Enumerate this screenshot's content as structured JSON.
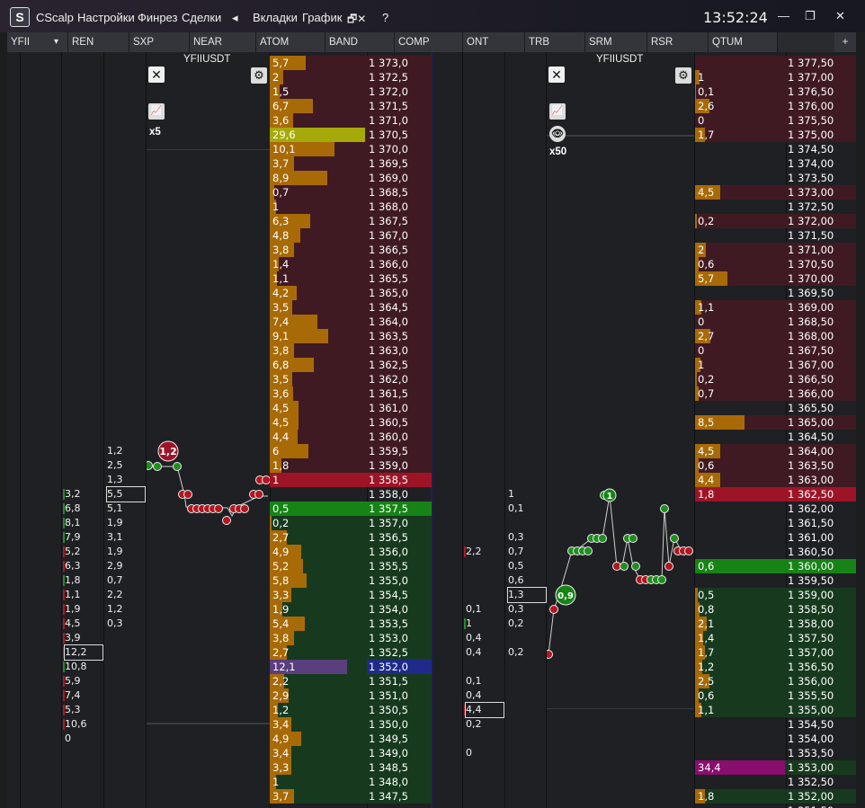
{
  "app": {
    "name": "CScalp",
    "logo_letter": "S"
  },
  "menu": [
    "Настройки",
    "Финрез",
    "Сделки",
    "◂",
    "Вкладки",
    "График",
    "🗗✕",
    "?"
  ],
  "clock": "13:52:24",
  "window_controls": [
    "—",
    "❐",
    "✕"
  ],
  "tabs": [
    "YFII",
    "REN",
    "SXP",
    "NEAR",
    "ATOM",
    "BAND",
    "COMP",
    "ONT",
    "TRB",
    "SRM",
    "RSR",
    "QTUM"
  ],
  "tab_dropdown_icon": "▾",
  "tab_add": "+",
  "left_panel": {
    "symbol": "YFIIUSDT",
    "multiplier": "x5",
    "close_icon": "✕",
    "gear_icon": "⚙",
    "chart_icon": "📈",
    "trade_bubble": "1,2",
    "cluster_a": [
      "3,2",
      "6,8",
      "8,1",
      "7,9",
      "5,2",
      "6,3",
      "1,8",
      "1,1",
      "1,9",
      "4,5",
      "3,9",
      "12,2",
      "10,8",
      "5,9",
      "7,4",
      "5,3",
      "10,6",
      "0"
    ],
    "cluster_b": [
      "1,2",
      "2,5",
      "1,3",
      "5,5",
      "5,1",
      "1,9",
      "3,1",
      "1,9",
      "2,9",
      "0,7",
      "2,2",
      "1,2",
      "0,3"
    ],
    "orderbook": [
      {
        "v": "5,7",
        "p": "1 373,0",
        "side": "ask",
        "w": 40
      },
      {
        "v": "2",
        "p": "1 372,5",
        "side": "ask",
        "w": 15
      },
      {
        "v": "1,5",
        "p": "1 372,0",
        "side": "ask",
        "w": 11
      },
      {
        "v": "6,7",
        "p": "1 371,5",
        "side": "ask",
        "w": 48
      },
      {
        "v": "3,6",
        "p": "1 371,0",
        "side": "ask",
        "w": 26
      },
      {
        "v": "29,6",
        "p": "1 370,5",
        "side": "ask",
        "w": 106,
        "hl": "#a5aa0a"
      },
      {
        "v": "10,1",
        "p": "1 370,0",
        "side": "ask",
        "w": 72
      },
      {
        "v": "3,7",
        "p": "1 369,5",
        "side": "ask",
        "w": 27
      },
      {
        "v": "8,9",
        "p": "1 369,0",
        "side": "ask",
        "w": 64
      },
      {
        "v": "0,7",
        "p": "1 368,5",
        "side": "ask",
        "w": 5
      },
      {
        "v": "1",
        "p": "1 368,0",
        "side": "ask",
        "w": 7
      },
      {
        "v": "6,3",
        "p": "1 367,5",
        "side": "ask",
        "w": 45
      },
      {
        "v": "4,8",
        "p": "1 367,0",
        "side": "ask",
        "w": 34
      },
      {
        "v": "3,8",
        "p": "1 366,5",
        "side": "ask",
        "w": 27
      },
      {
        "v": "1,4",
        "p": "1 366,0",
        "side": "ask",
        "w": 10
      },
      {
        "v": "1,1",
        "p": "1 365,5",
        "side": "ask",
        "w": 8
      },
      {
        "v": "4,2",
        "p": "1 365,0",
        "side": "ask",
        "w": 30
      },
      {
        "v": "3,5",
        "p": "1 364,5",
        "side": "ask",
        "w": 25
      },
      {
        "v": "7,4",
        "p": "1 364,0",
        "side": "ask",
        "w": 53
      },
      {
        "v": "9,1",
        "p": "1 363,5",
        "side": "ask",
        "w": 65
      },
      {
        "v": "3,8",
        "p": "1 363,0",
        "side": "ask",
        "w": 27
      },
      {
        "v": "6,8",
        "p": "1 362,5",
        "side": "ask",
        "w": 49
      },
      {
        "v": "3,5",
        "p": "1 362,0",
        "side": "ask",
        "w": 25
      },
      {
        "v": "3,6",
        "p": "1 361,5",
        "side": "ask",
        "w": 26
      },
      {
        "v": "4,5",
        "p": "1 361,0",
        "side": "ask",
        "w": 32
      },
      {
        "v": "4,5",
        "p": "1 360,5",
        "side": "ask",
        "w": 32
      },
      {
        "v": "4,4",
        "p": "1 360,0",
        "side": "ask",
        "w": 31
      },
      {
        "v": "6",
        "p": "1 359,5",
        "side": "ask",
        "w": 43
      },
      {
        "v": "1,8",
        "p": "1 359,0",
        "side": "ask",
        "w": 13
      },
      {
        "v": "1",
        "p": "1 358,5",
        "side": "bestask",
        "w": 0
      },
      {
        "v": "",
        "p": "1 358,0",
        "side": "empty",
        "w": 0
      },
      {
        "v": "0,5",
        "p": "1 357,5",
        "side": "bestbid",
        "w": 0
      },
      {
        "v": "0,2",
        "p": "1 357,0",
        "side": "bid",
        "w": 2
      },
      {
        "v": "2,7",
        "p": "1 356,5",
        "side": "bid",
        "w": 19
      },
      {
        "v": "4,9",
        "p": "1 356,0",
        "side": "bid",
        "w": 35
      },
      {
        "v": "5,2",
        "p": "1 355,5",
        "side": "bid",
        "w": 37
      },
      {
        "v": "5,8",
        "p": "1 355,0",
        "side": "bid",
        "w": 41
      },
      {
        "v": "3,3",
        "p": "1 354,5",
        "side": "bid",
        "w": 24
      },
      {
        "v": "1,9",
        "p": "1 354,0",
        "side": "bid",
        "w": 14
      },
      {
        "v": "5,4",
        "p": "1 353,5",
        "side": "bid",
        "w": 39
      },
      {
        "v": "3,8",
        "p": "1 353,0",
        "side": "bid",
        "w": 27
      },
      {
        "v": "2,7",
        "p": "1 352,5",
        "side": "bid",
        "w": 19
      },
      {
        "v": "12,1",
        "p": "1 352,0",
        "side": "bid",
        "w": 86,
        "hl": "#5a3e7e",
        "phl": "#1f2a8a"
      },
      {
        "v": "2,2",
        "p": "1 351,5",
        "side": "bid",
        "w": 16
      },
      {
        "v": "2,9",
        "p": "1 351,0",
        "side": "bid",
        "w": 21
      },
      {
        "v": "1,2",
        "p": "1 350,5",
        "side": "bid",
        "w": 9
      },
      {
        "v": "3,4",
        "p": "1 350,0",
        "side": "bid",
        "w": 24
      },
      {
        "v": "4,9",
        "p": "1 349,5",
        "side": "bid",
        "w": 35
      },
      {
        "v": "3,4",
        "p": "1 349,0",
        "side": "bid",
        "w": 24
      },
      {
        "v": "3,3",
        "p": "1 348,5",
        "side": "bid",
        "w": 24
      },
      {
        "v": "1",
        "p": "1 348,0",
        "side": "bid",
        "w": 7
      },
      {
        "v": "3,7",
        "p": "1 347,5",
        "side": "bid",
        "w": 27
      }
    ]
  },
  "right_panel": {
    "symbol": "YFIIUSDT",
    "multiplier": "x50",
    "close_icon": "✕",
    "gear_icon": "⚙",
    "chart_icon": "📈",
    "eye_icon": "👁",
    "trade_bubble_a": "1",
    "trade_bubble_b": "0,9",
    "cluster_a": [
      "2,2",
      "1",
      "0,1",
      "0,4",
      "0,4",
      "0,1",
      "0,4",
      "4,4",
      "0,2",
      "0"
    ],
    "cluster_b": [
      "1",
      "0,1",
      "0,3",
      "0,7",
      "0,5",
      "0,6",
      "1,3",
      "0,3",
      "0,2",
      "0,2"
    ],
    "orderbook": [
      {
        "v": "",
        "p": "1 377,50",
        "side": "askdark",
        "w": 0
      },
      {
        "v": "1",
        "p": "1 377,00",
        "side": "ask",
        "w": 5
      },
      {
        "v": "0,1",
        "p": "1 376,50",
        "side": "ask",
        "w": 1
      },
      {
        "v": "2,6",
        "p": "1 376,00",
        "side": "ask",
        "w": 16
      },
      {
        "v": "0",
        "p": "1 375,50",
        "side": "ask",
        "w": 0
      },
      {
        "v": "1,7",
        "p": "1 375,00",
        "side": "ask",
        "w": 11
      },
      {
        "v": "",
        "p": "1 374,50",
        "side": "empty",
        "w": 0
      },
      {
        "v": "",
        "p": "1 374,00",
        "side": "empty",
        "w": 0
      },
      {
        "v": "",
        "p": "1 373,50",
        "side": "empty",
        "w": 0
      },
      {
        "v": "4,5",
        "p": "1 373,00",
        "side": "ask",
        "w": 28
      },
      {
        "v": "",
        "p": "1 372,50",
        "side": "empty",
        "w": 0
      },
      {
        "v": "0,2",
        "p": "1 372,00",
        "side": "ask",
        "w": 2
      },
      {
        "v": "",
        "p": "1 371,50",
        "side": "empty",
        "w": 0
      },
      {
        "v": "2",
        "p": "1 371,00",
        "side": "ask",
        "w": 12
      },
      {
        "v": "0,6",
        "p": "1 370,50",
        "side": "ask",
        "w": 4
      },
      {
        "v": "5,7",
        "p": "1 370,00",
        "side": "ask",
        "w": 36
      },
      {
        "v": "",
        "p": "1 369,50",
        "side": "empty",
        "w": 0
      },
      {
        "v": "1,1",
        "p": "1 369,00",
        "side": "ask",
        "w": 7
      },
      {
        "v": "0",
        "p": "1 368,50",
        "side": "ask",
        "w": 0
      },
      {
        "v": "2,7",
        "p": "1 368,00",
        "side": "ask",
        "w": 17
      },
      {
        "v": "0",
        "p": "1 367,50",
        "side": "ask",
        "w": 0
      },
      {
        "v": "1",
        "p": "1 367,00",
        "side": "ask",
        "w": 6
      },
      {
        "v": "0,2",
        "p": "1 366,50",
        "side": "ask",
        "w": 2
      },
      {
        "v": "0,7",
        "p": "1 366,00",
        "side": "ask",
        "w": 4
      },
      {
        "v": "",
        "p": "1 365,50",
        "side": "empty",
        "w": 0
      },
      {
        "v": "8,5",
        "p": "1 365,00",
        "side": "ask",
        "w": 55
      },
      {
        "v": "",
        "p": "1 364,50",
        "side": "empty",
        "w": 0
      },
      {
        "v": "4,5",
        "p": "1 364,00",
        "side": "ask",
        "w": 28
      },
      {
        "v": "0,6",
        "p": "1 363,50",
        "side": "ask",
        "w": 4
      },
      {
        "v": "4,4",
        "p": "1 363,00",
        "side": "ask",
        "w": 28
      },
      {
        "v": "1,8",
        "p": "1 362,50",
        "side": "bestask",
        "w": 0
      },
      {
        "v": "",
        "p": "1 362,00",
        "side": "empty",
        "w": 0
      },
      {
        "v": "",
        "p": "1 361,50",
        "side": "empty",
        "w": 0
      },
      {
        "v": "",
        "p": "1 361,00",
        "side": "empty",
        "w": 0
      },
      {
        "v": "",
        "p": "1 360,50",
        "side": "empty",
        "w": 0
      },
      {
        "v": "0,6",
        "p": "1 360,00",
        "side": "bestbid",
        "w": 0
      },
      {
        "v": "",
        "p": "1 359,50",
        "side": "empty",
        "w": 0
      },
      {
        "v": "0,5",
        "p": "1 359,00",
        "side": "bid",
        "w": 3
      },
      {
        "v": "0,8",
        "p": "1 358,50",
        "side": "bid",
        "w": 5
      },
      {
        "v": "2,1",
        "p": "1 358,00",
        "side": "bid",
        "w": 13
      },
      {
        "v": "1,4",
        "p": "1 357,50",
        "side": "bid",
        "w": 9
      },
      {
        "v": "1,7",
        "p": "1 357,00",
        "side": "bid",
        "w": 11
      },
      {
        "v": "1,2",
        "p": "1 356,50",
        "side": "bid",
        "w": 8
      },
      {
        "v": "2,5",
        "p": "1 356,00",
        "side": "bid",
        "w": 16
      },
      {
        "v": "0,6",
        "p": "1 355,50",
        "side": "bid",
        "w": 4
      },
      {
        "v": "1,1",
        "p": "1 355,00",
        "side": "bid",
        "w": 7
      },
      {
        "v": "",
        "p": "1 354,50",
        "side": "empty",
        "w": 0
      },
      {
        "v": "",
        "p": "1 354,00",
        "side": "empty",
        "w": 0
      },
      {
        "v": "",
        "p": "1 353,50",
        "side": "empty",
        "w": 0
      },
      {
        "v": "34,4",
        "p": "1 353,00",
        "side": "bid",
        "w": 100,
        "hl": "#8a0e6e"
      },
      {
        "v": "",
        "p": "1 352,50",
        "side": "empty",
        "w": 0
      },
      {
        "v": "1,8",
        "p": "1 352,00",
        "side": "bid",
        "w": 11
      },
      {
        "v": "",
        "p": "1 351,50",
        "side": "empty",
        "w": 0
      }
    ]
  }
}
